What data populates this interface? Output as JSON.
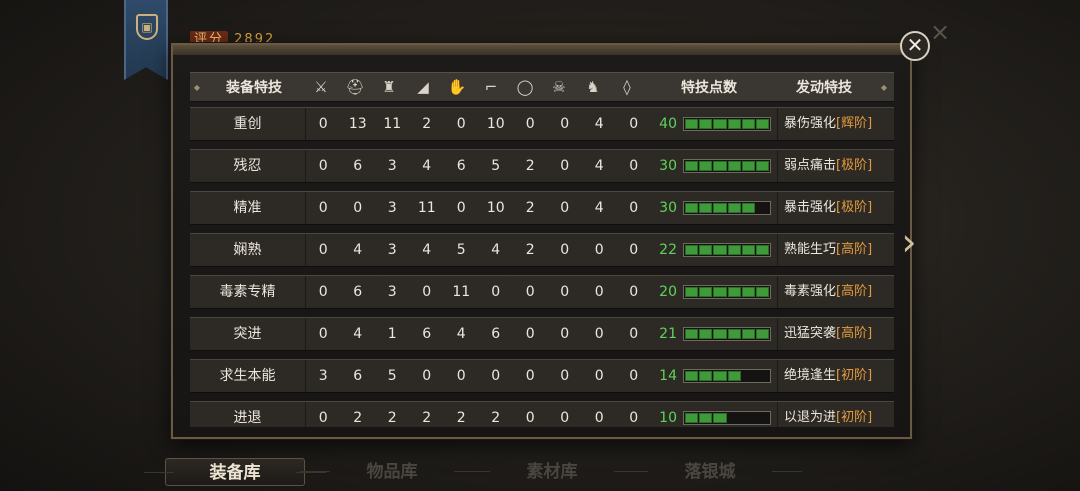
{
  "score": {
    "label": "评分",
    "value": "2892"
  },
  "header": {
    "name": "装备特技",
    "icons": [
      "sword-icon",
      "helmet-icon",
      "armor-icon",
      "shoulder-icon",
      "gloves-icon",
      "boots-icon",
      "ring-icon",
      "mask-icon",
      "horse-icon",
      "amulet-icon"
    ],
    "icon_glyphs": [
      "⚔",
      "⛑",
      "♜",
      "◢",
      "✋",
      "⌐",
      "◯",
      "☠",
      "♞",
      "◊"
    ],
    "points": "特技点数",
    "skill": "发动特技"
  },
  "close_glyph": "✕",
  "next_glyph": "›",
  "rows": [
    {
      "name": "重创",
      "values": [
        "0",
        "13",
        "11",
        "2",
        "0",
        "10",
        "0",
        "0",
        "4",
        "0"
      ],
      "points": "40",
      "level": 1.0,
      "skill": "暴伤强化",
      "tier": "[辉阶]"
    },
    {
      "name": "残忍",
      "values": [
        "0",
        "6",
        "3",
        "4",
        "6",
        "5",
        "2",
        "0",
        "4",
        "0"
      ],
      "points": "30",
      "level": 1.0,
      "skill": "弱点痛击",
      "tier": "[极阶]"
    },
    {
      "name": "精准",
      "values": [
        "0",
        "0",
        "3",
        "11",
        "0",
        "10",
        "2",
        "0",
        "4",
        "0"
      ],
      "points": "30",
      "level": 0.75,
      "skill": "暴击强化",
      "tier": "[极阶]"
    },
    {
      "name": "娴熟",
      "values": [
        "0",
        "4",
        "3",
        "4",
        "5",
        "4",
        "2",
        "0",
        "0",
        "0"
      ],
      "points": "22",
      "level": 1.0,
      "skill": "熟能生巧",
      "tier": "[高阶]"
    },
    {
      "name": "毒素专精",
      "values": [
        "0",
        "6",
        "3",
        "0",
        "11",
        "0",
        "0",
        "0",
        "0",
        "0"
      ],
      "points": "20",
      "level": 1.0,
      "skill": "毒素强化",
      "tier": "[高阶]"
    },
    {
      "name": "突进",
      "values": [
        "0",
        "4",
        "1",
        "6",
        "4",
        "6",
        "0",
        "0",
        "0",
        "0"
      ],
      "points": "21",
      "level": 1.0,
      "skill": "迅猛突袭",
      "tier": "[高阶]"
    },
    {
      "name": "求生本能",
      "values": [
        "3",
        "6",
        "5",
        "0",
        "0",
        "0",
        "0",
        "0",
        "0",
        "0"
      ],
      "points": "14",
      "level": 0.67,
      "skill": "绝境逢生",
      "tier": "[初阶]"
    },
    {
      "name": "进退",
      "values": [
        "0",
        "2",
        "2",
        "2",
        "2",
        "2",
        "0",
        "0",
        "0",
        "0"
      ],
      "points": "10",
      "level": 0.5,
      "skill": "以退为进",
      "tier": "[初阶]"
    }
  ],
  "tabs": [
    {
      "label": "装备库",
      "active": true
    },
    {
      "label": "物品库",
      "active": false
    },
    {
      "label": "素材库",
      "active": false
    },
    {
      "label": "落银城",
      "active": false
    }
  ]
}
